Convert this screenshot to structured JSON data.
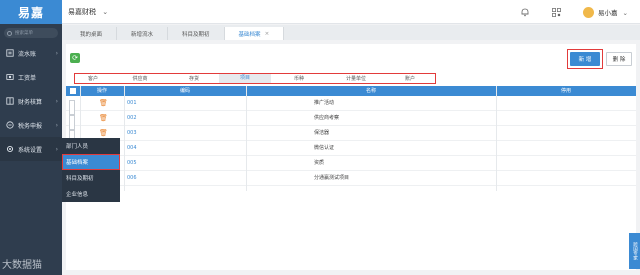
{
  "sidebar": {
    "logo": "易嘉",
    "search_placeholder": "搜索菜单",
    "items": [
      {
        "label": "流水账",
        "icon": "ledger-icon"
      },
      {
        "label": "工资单",
        "icon": "payroll-icon"
      },
      {
        "label": "财务核算",
        "icon": "accounting-icon"
      },
      {
        "label": "税务申报",
        "icon": "tax-icon"
      },
      {
        "label": "系统设置",
        "icon": "gear-icon"
      }
    ],
    "watermark": "大数据猫"
  },
  "flyout": {
    "items": [
      "部门人员",
      "基础档案",
      "科目及期初",
      "企业信息"
    ]
  },
  "topbar": {
    "company": "易嘉财税",
    "user": "易小嘉"
  },
  "tabs": [
    {
      "label": "我的桌面"
    },
    {
      "label": "新增流水"
    },
    {
      "label": "科目及期初"
    },
    {
      "label": "基础档案"
    }
  ],
  "toolbar": {
    "add_label": "新 增",
    "delete_label": "删 除"
  },
  "sub_tabs": [
    "客户",
    "供应商",
    "存货",
    "项目",
    "币种",
    "计量单位",
    "账户"
  ],
  "table": {
    "headers": {
      "op": "操作",
      "code": "编码",
      "name": "名称",
      "enabled": "停用"
    },
    "rows": [
      {
        "code": "001",
        "name": "推广活动"
      },
      {
        "code": "002",
        "name": "供应商考察"
      },
      {
        "code": "003",
        "name": "保洁器"
      },
      {
        "code": "004",
        "name": "微信认证"
      },
      {
        "code": "005",
        "name": "资质"
      },
      {
        "code": "006",
        "name": "分通赢测试项目"
      }
    ]
  },
  "side_tab": "跨国专家",
  "colors": {
    "accent": "#3b8ad3",
    "sidebar": "#2f3d4e",
    "highlight": "#e23b3b"
  }
}
